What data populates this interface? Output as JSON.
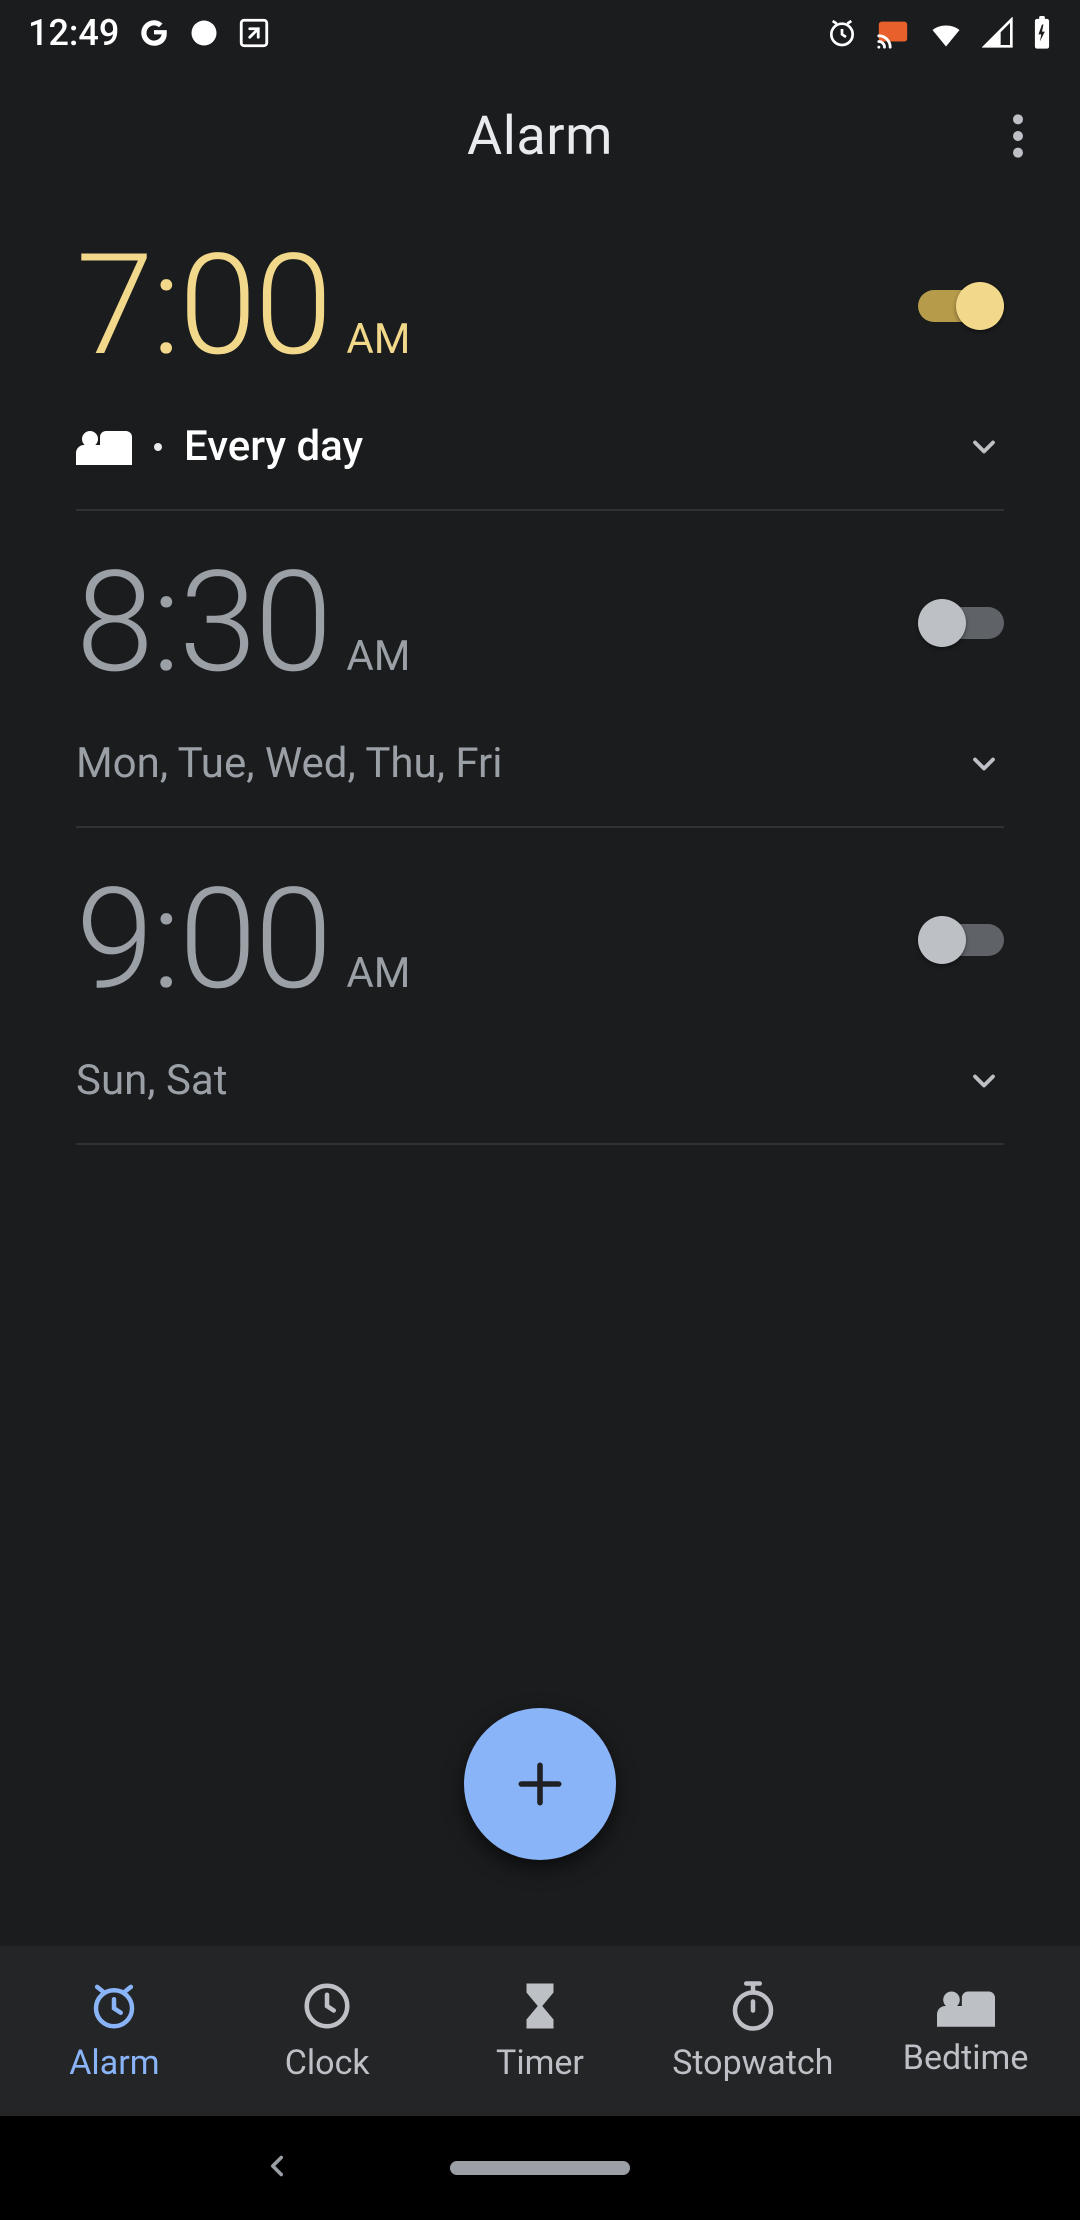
{
  "status_bar": {
    "time": "12:49"
  },
  "app_bar": {
    "title": "Alarm"
  },
  "alarms": [
    {
      "time": "7:00",
      "suffix": "AM",
      "enabled": true,
      "bedtime_linked": true,
      "schedule": "Every day"
    },
    {
      "time": "8:30",
      "suffix": "AM",
      "enabled": false,
      "bedtime_linked": false,
      "schedule": "Mon, Tue, Wed, Thu, Fri"
    },
    {
      "time": "9:00",
      "suffix": "AM",
      "enabled": false,
      "bedtime_linked": false,
      "schedule": "Sun, Sat"
    }
  ],
  "bottom_nav": {
    "items": [
      {
        "label": "Alarm",
        "active": true
      },
      {
        "label": "Clock",
        "active": false
      },
      {
        "label": "Timer",
        "active": false
      },
      {
        "label": "Stopwatch",
        "active": false
      },
      {
        "label": "Bedtime",
        "active": false
      }
    ]
  },
  "colors": {
    "accent_yellow": "#f2d88a",
    "accent_blue": "#8ab4f8",
    "bg": "#1b1c1e",
    "nav_bg": "#242527",
    "text_inactive": "#9aa0a6"
  }
}
